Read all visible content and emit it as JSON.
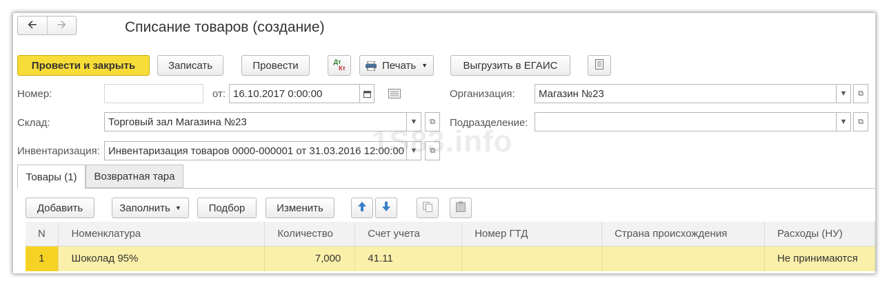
{
  "window": {
    "title": "Списание товаров (создание)"
  },
  "toolbar": {
    "post_close": "Провести и закрыть",
    "save": "Записать",
    "post": "Провести",
    "dt_kt_top": "Дт",
    "dt_kt_bottom": "Кт",
    "print": "Печать",
    "export": "Выгрузить в ЕГАИС"
  },
  "form": {
    "number_label": "Номер:",
    "number_value": "",
    "date_label": "от:",
    "date_value": "16.10.2017  0:00:00",
    "org_label": "Организация:",
    "org_value": "Магазин №23",
    "warehouse_label": "Склад:",
    "warehouse_value": "Торговый зал Магазина №23",
    "division_label": "Подразделение:",
    "division_value": "",
    "inventory_label": "Инвентаризация:",
    "inventory_value": "Инвентаризация товаров 0000-000001 от 31.03.2016 12:00:00"
  },
  "tabs": [
    {
      "label": "Товары (1)"
    },
    {
      "label": "Возвратная тара"
    }
  ],
  "table_toolbar": {
    "add": "Добавить",
    "fill": "Заполнить",
    "select": "Подбор",
    "change": "Изменить"
  },
  "table": {
    "columns": [
      "N",
      "Номенклатура",
      "Количество",
      "Счет учета",
      "Номер ГТД",
      "Страна происхождения",
      "Расходы (НУ)"
    ],
    "rows": [
      [
        "1",
        "Шоколад 95%",
        "7,000",
        "41.11",
        "",
        "",
        "Не принимаются"
      ]
    ]
  },
  "watermark": "1S83.info",
  "colors": {
    "primary_button": "#f8dc38",
    "selected_row": "#fbf0a9",
    "row_number": "#f5d224"
  }
}
